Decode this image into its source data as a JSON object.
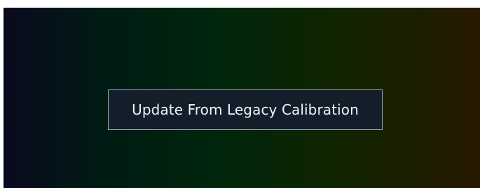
{
  "panel": {
    "button_label": "Update From Legacy Calibration"
  }
}
